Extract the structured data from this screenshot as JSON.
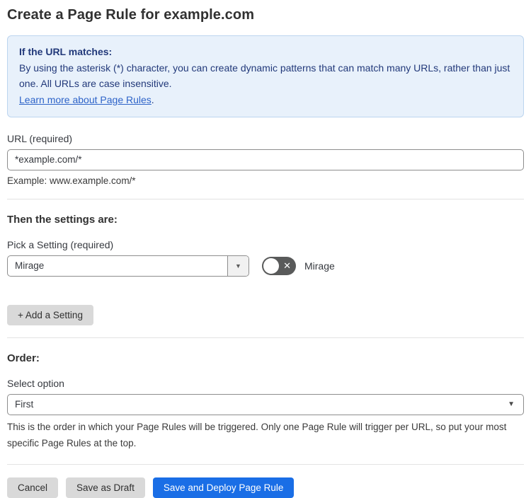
{
  "page": {
    "title": "Create a Page Rule for example.com"
  },
  "info_box": {
    "heading": "If the URL matches:",
    "body": "By using the asterisk (*) character, you can create dynamic patterns that can match many URLs, rather than just one. All URLs are case insensitive.",
    "link_label": "Learn more about Page Rules",
    "link_suffix": "."
  },
  "url_field": {
    "label": "URL (required)",
    "value": "*example.com/*",
    "helper": "Example: www.example.com/*"
  },
  "settings_section": {
    "heading": "Then the settings are:",
    "picker_label": "Pick a Setting (required)",
    "picker_value": "Mirage",
    "picker_arrow": "▼",
    "toggle_label": "Mirage",
    "toggle_state": "off",
    "toggle_x": "✕",
    "add_setting_label": "+ Add a Setting"
  },
  "order_section": {
    "heading": "Order:",
    "select_label": "Select option",
    "select_value": "First",
    "select_arrow": "▼",
    "helper": "This is the order in which your Page Rules will be triggered. Only one Page Rule will trigger per URL, so put your most specific Page Rules at the top."
  },
  "footer": {
    "cancel_label": "Cancel",
    "save_draft_label": "Save as Draft",
    "save_deploy_label": "Save and Deploy Page Rule"
  },
  "colors": {
    "accent_blue": "#1a6ee6",
    "info_bg": "#e8f1fb",
    "info_border": "#bcd5ef",
    "info_text": "#22397a",
    "link_blue": "#2d63c8",
    "toggle_off_bg": "#595a5a",
    "button_gray": "#d9d9d9"
  }
}
